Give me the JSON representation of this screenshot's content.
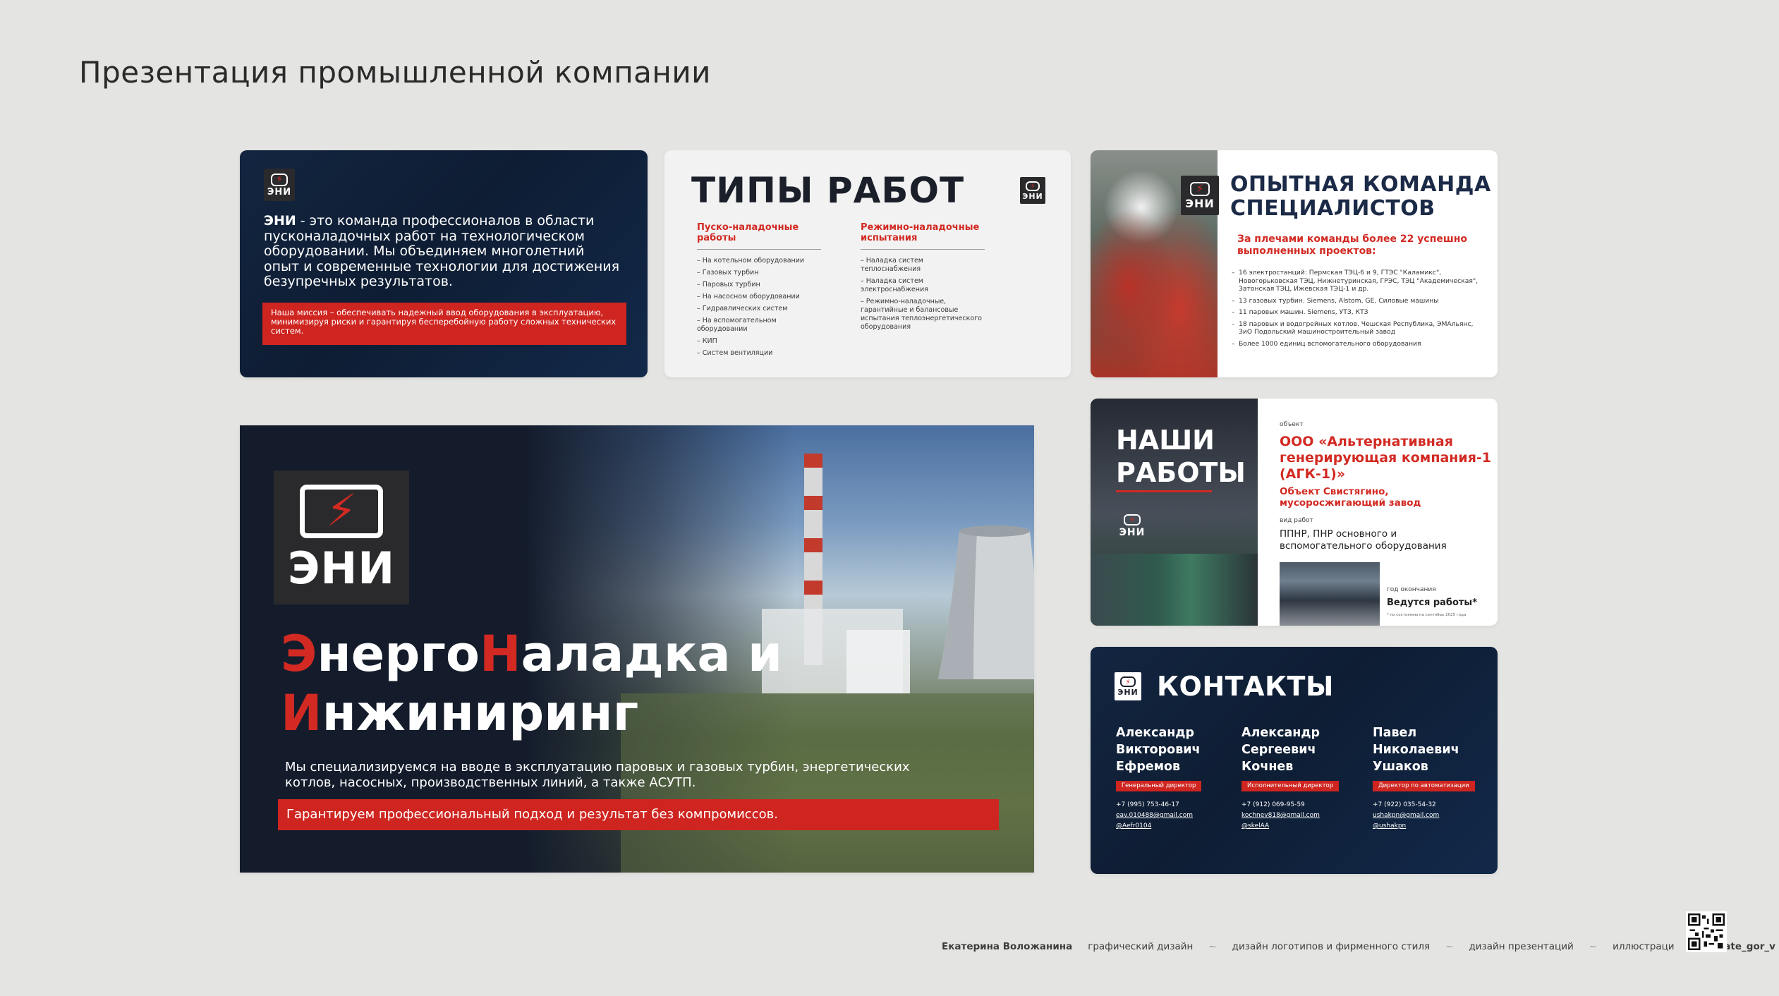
{
  "page": {
    "title": "Презентация промышленной компании"
  },
  "brand": {
    "logo_word": "ЭНИ",
    "accent": "#d22a23",
    "navy": "#132540"
  },
  "slide1": {
    "name": "ЭНИ",
    "intro": " - это команда профессионалов в области пусконаладочных работ на технологическом оборудовании. Мы объединяем многолетний опыт и современные технологии для достижения безупречных результатов.",
    "mission": "Наша миссия – обеспечивать надежный ввод оборудования в эксплуатацию, минимизируя риски и гарантируя бесперебойную работу сложных технических систем."
  },
  "slide2": {
    "title": "ТИПЫ РАБОТ",
    "col1": {
      "heading": "Пуско-наладочные работы",
      "items": [
        "На котельном оборудовании",
        "Газовых турбин",
        "Паровых турбин",
        "На насосном оборудовании",
        "Гидравлических систем",
        "На вспомогательном оборудовании",
        "КИП",
        "Систем вентиляции"
      ]
    },
    "col2": {
      "heading": "Режимно-наладочные испытания",
      "items": [
        "Наладка систем теплоснабжения",
        "Наладка систем электроснабжения",
        "Режимно-наладочные, гарантийные и балансовые испытания теплоэнергетического оборудования"
      ]
    }
  },
  "slide3": {
    "title_line1": "ОПЫТНАЯ КОМАНДА",
    "title_line2": "СПЕЦИАЛИСТОВ",
    "subtitle": "За плечами команды более 22 успешно выполненных проектов:",
    "items": [
      "16 электростанций: Пермская ТЭЦ-6 и 9, ГТЭС \"Каламикс\", Новогорьковская ТЭЦ, Нижнетуринская, ГРЭС, ТЭЦ \"Академическая\", Затонская ТЭЦ, Ижевская ТЭЦ-1 и др.",
      "13 газовых турбин. Siemens, Alstom, GE, Силовые машины",
      "11 паровых машин. Siemens, УТЗ, КТЗ",
      "18 паровых и водогрейных котлов. Чешская Республика, ЭМАльянс, ЗиО Подольский машиностроительный завод",
      "Более 1000 единиц вспомогательного оборудования"
    ]
  },
  "slide4": {
    "title_l1_red": "Э",
    "title_l1_a": "нерго",
    "title_l1_red2": "Н",
    "title_l1_b": "аладка и",
    "title_l2_red": "И",
    "title_l2_a": "нжиниринг",
    "desc": "Мы специализируемся на вводе в эксплуатацию паровых и газовых турбин, энергетических котлов, насосных, производственных линий, а также АСУТП.",
    "guarantee": "Гарантируем профессиональный подход и результат без компромиссов."
  },
  "slide5": {
    "title_l1": "НАШИ",
    "title_l2": "РАБОТЫ",
    "label_object": "объект",
    "object": "ООО «Альтернативная генерирующая компания-1 (АГК-1)»",
    "object_sub": "Объект Свистягино, мусоросжигающий завод",
    "label_work": "вид работ",
    "work": "ППНР, ПНР основного и вспомогательного оборудования",
    "label_end": "год окончания",
    "end": "Ведутся работы*",
    "note": "* по состоянию на сентябрь 2025 года"
  },
  "slide6": {
    "title": "КОНТАКТЫ",
    "people": [
      {
        "name_l1": "Александр",
        "name_l2": "Викторович",
        "name_l3": "Ефремов",
        "role": "Генеральный директор",
        "phone": "+7 (995) 753-46-17",
        "email": "eav.010488@gmail.com",
        "tg": "@Aefr0104"
      },
      {
        "name_l1": "Александр",
        "name_l2": "Сергеевич",
        "name_l3": "Кочнев",
        "role": "Исполнительный директор",
        "phone": "+7 (912) 069-95-59",
        "email": "kochnev818@gmail.com",
        "tg": "@skelAA"
      },
      {
        "name_l1": "Павел",
        "name_l2": "Николаевич",
        "name_l3": "Ушаков",
        "role": "Директор по автоматизации",
        "phone": "+7 (922) 035-54-32",
        "email": "ushakpn@gmail.com",
        "tg": "@ushakpn"
      }
    ]
  },
  "footer": {
    "author": "Екатерина Воложанина",
    "s1": "графический дизайн",
    "s2": "дизайн логотипов и фирменного стиля",
    "s3": "дизайн презентаций",
    "s4": "иллюстраци",
    "sep": "~",
    "link": "t.me/kate_gor_v"
  }
}
